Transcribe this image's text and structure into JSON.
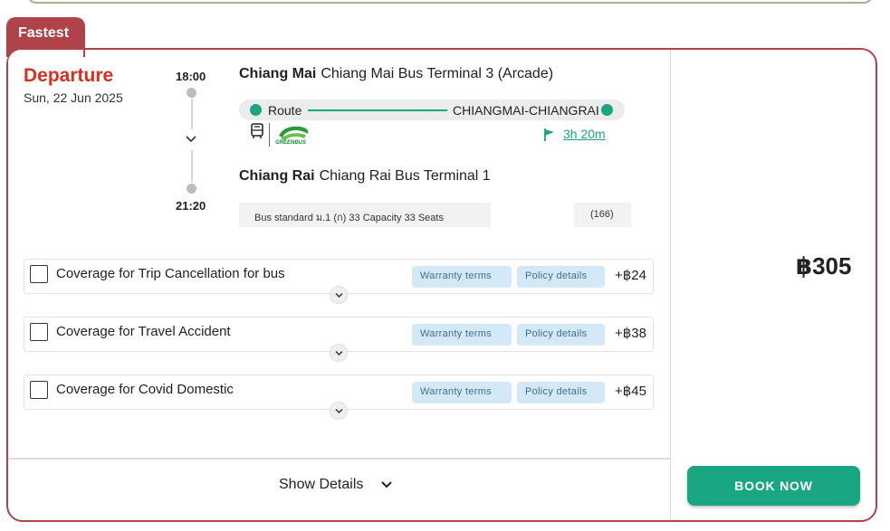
{
  "tag": "Fastest",
  "departure": {
    "label": "Departure",
    "date": "Sun, 22 Jun 2025"
  },
  "times": {
    "depart": "18:00",
    "arrive": "21:20"
  },
  "origin": {
    "city": "Chiang Mai",
    "terminal": "Chiang Mai Bus Terminal 3 (Arcade)"
  },
  "destination": {
    "city": "Chiang Rai",
    "terminal": "Chiang Rai Bus Terminal 1"
  },
  "route": {
    "label": "Route",
    "name": "CHIANGMAI-CHIANGRAI"
  },
  "operator": {
    "logo_text": "GREENBUS",
    "duration": "3h 20m"
  },
  "bus": {
    "info": "Bus standard ม.1 (ก) 33 Capacity 33 Seats",
    "count": "(166)"
  },
  "coverages": [
    {
      "label": "Coverage for Trip Cancellation for bus",
      "warranty": "Warranty terms",
      "policy": "Policy details",
      "price": "+฿24"
    },
    {
      "label": "Coverage for Travel Accident",
      "warranty": "Warranty terms",
      "policy": "Policy details",
      "price": "+฿38"
    },
    {
      "label": "Coverage for Covid Domestic",
      "warranty": "Warranty terms",
      "policy": "Policy details",
      "price": "+฿45"
    }
  ],
  "show_details": "Show Details",
  "price": "฿305",
  "book_now": "BOOK NOW",
  "colors": {
    "accent": "#1aa583",
    "brand_red": "#b0434a",
    "departure_red": "#d6301e"
  }
}
